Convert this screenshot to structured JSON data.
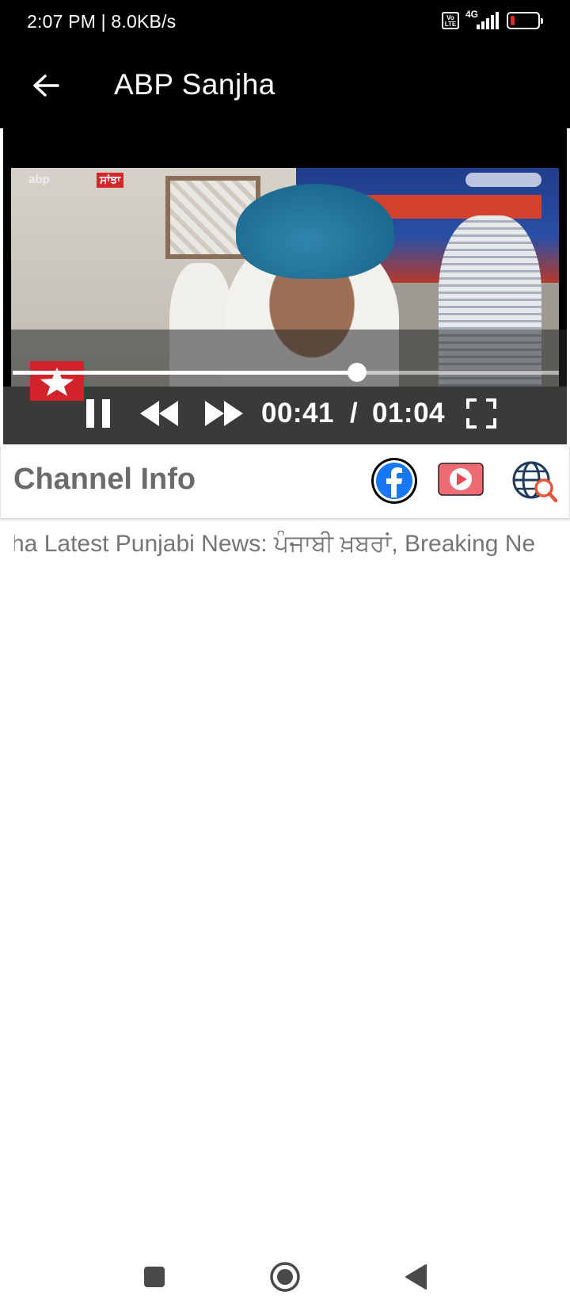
{
  "status_bar": {
    "time_speed": "2:07 PM | 8.0KB/s",
    "volte_label": "Vo LTE",
    "network_label": "4G",
    "battery_color": "#e3262b"
  },
  "app_bar": {
    "title": "ABP Sanjha",
    "back_icon": "arrow-left-icon"
  },
  "player": {
    "video_logo_text": "abp",
    "video_logo_tag": "ਸਾਂਝਾ",
    "progress_fraction": 0.63,
    "position": "00:41",
    "separator": "/",
    "duration": "01:04",
    "controls": [
      "pause-icon",
      "rewind-icon",
      "fast-forward-icon",
      "fullscreen-icon"
    ]
  },
  "channel_info": {
    "title": "Channel Info",
    "links": [
      "facebook-icon",
      "youtube-icon",
      "website-search-icon"
    ],
    "ticker": "ha Latest Punjabi News: ਪੰਜਾਬੀ ਖ਼ਬਰਾਂ, Breaking Ne"
  },
  "nav_bar": {
    "buttons": [
      "recents-icon",
      "home-icon",
      "back-icon"
    ]
  }
}
